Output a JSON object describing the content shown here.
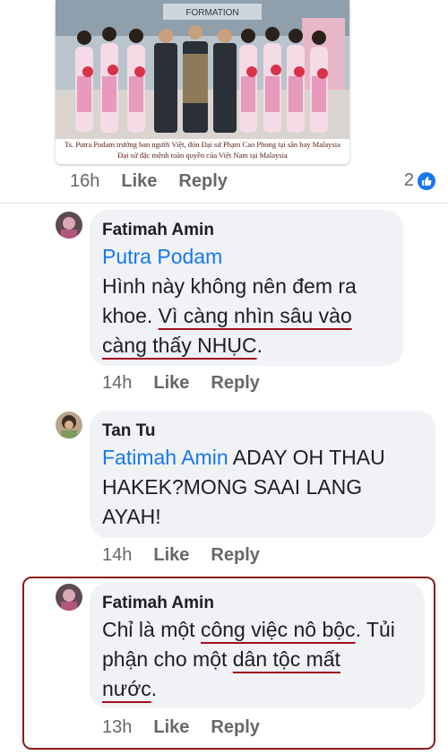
{
  "post": {
    "caption_line1": "Ts. Putra Podam trưởng ban người Việt, đón Đại sứ Phạm Cao Phong tại sân bay Malaysia",
    "caption_line2": "Đại sứ đặc mệnh toàn quyền của Việt Nam tại Malaysia",
    "banner_text": "FORMATION",
    "time": "16h",
    "like_label": "Like",
    "reply_label": "Reply",
    "reaction_count": "2"
  },
  "comments": [
    {
      "author": "Fatimah Amin",
      "mention": "Putra Podam",
      "text_plain1": "Hình này không nên đem ra khoe. ",
      "text_ul1": "Vì càng nhìn sâu vào",
      "text_ul2": "càng thấy NHỤC",
      "text_end": ".",
      "time": "14h",
      "like_label": "Like",
      "reply_label": "Reply"
    },
    {
      "author": "Tan Tu",
      "mention": "Fatimah Amin",
      "text": " ADAY OH THAU HAKEK?MONG SAAI LANG AYAH!",
      "time": "14h",
      "like_label": "Like",
      "reply_label": "Reply"
    },
    {
      "author": "Fatimah Amin",
      "text_p1": "Chỉ là một ",
      "text_ul1": "công việc nô bộc",
      "text_p2": ". Tủi phận cho một ",
      "text_ul2": "dân tộc mất",
      "text_ul3": "nước",
      "text_end": ".",
      "time": "13h",
      "like_label": "Like",
      "reply_label": "Reply"
    }
  ],
  "colors": {
    "link": "#1877f2",
    "meta": "#65676b",
    "bubble": "#f0f2f5",
    "highlight_border": "#8b1a1a"
  }
}
